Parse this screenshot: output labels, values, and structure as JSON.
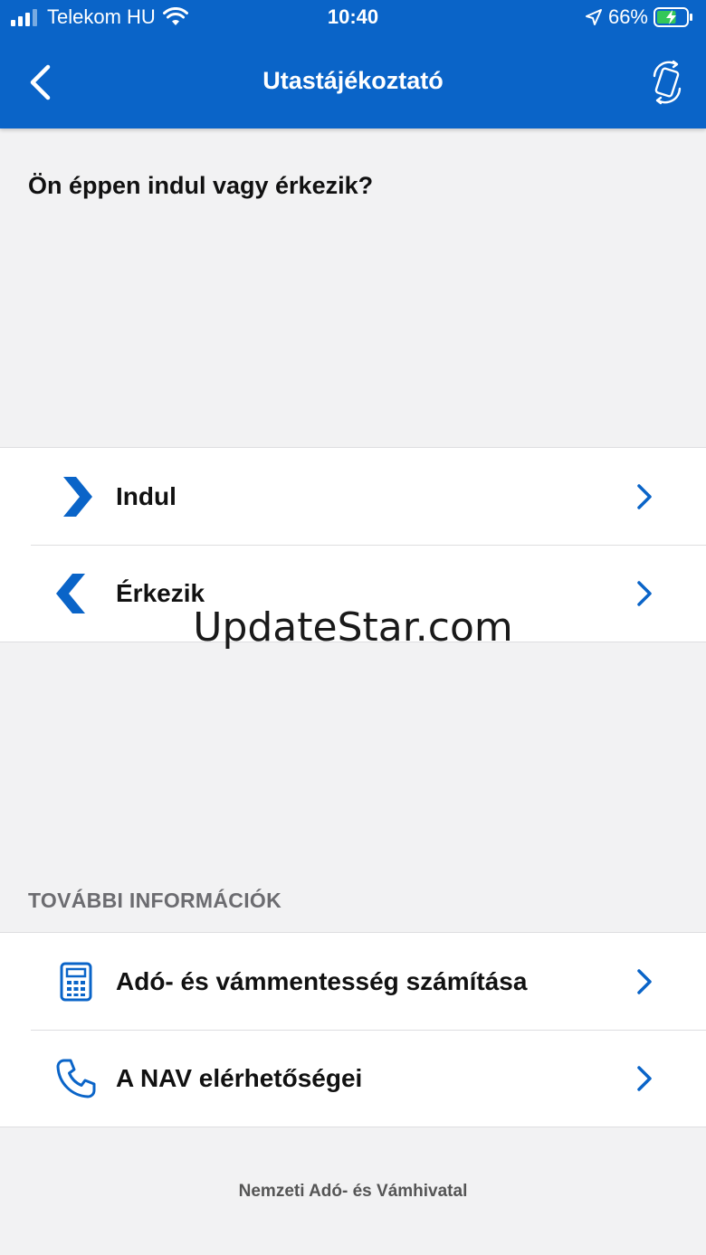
{
  "status_bar": {
    "carrier": "Telekom HU",
    "time": "10:40",
    "battery_percent": "66%",
    "battery_level": 0.66
  },
  "nav": {
    "title": "Utastájékoztató"
  },
  "question": "Ön éppen indul vagy érkezik?",
  "trip_options": [
    {
      "label": "Indul",
      "icon": "chevron-right-arrow-icon"
    },
    {
      "label": "Érkezik",
      "icon": "chevron-left-arrow-icon"
    }
  ],
  "more_info": {
    "section_label": "TOVÁBBI INFORMÁCIÓK",
    "items": [
      {
        "label": "Adó- és vámmentesség számítása",
        "icon": "calculator-icon"
      },
      {
        "label": "A NAV elérhetőségei",
        "icon": "phone-icon"
      }
    ]
  },
  "watermark": "UpdateStar.com",
  "footer": "Nemzeti Adó- és Vámhivatal",
  "colors": {
    "brand_blue": "#0a64c8",
    "background": "#f2f2f3",
    "battery_green": "#34c759"
  }
}
